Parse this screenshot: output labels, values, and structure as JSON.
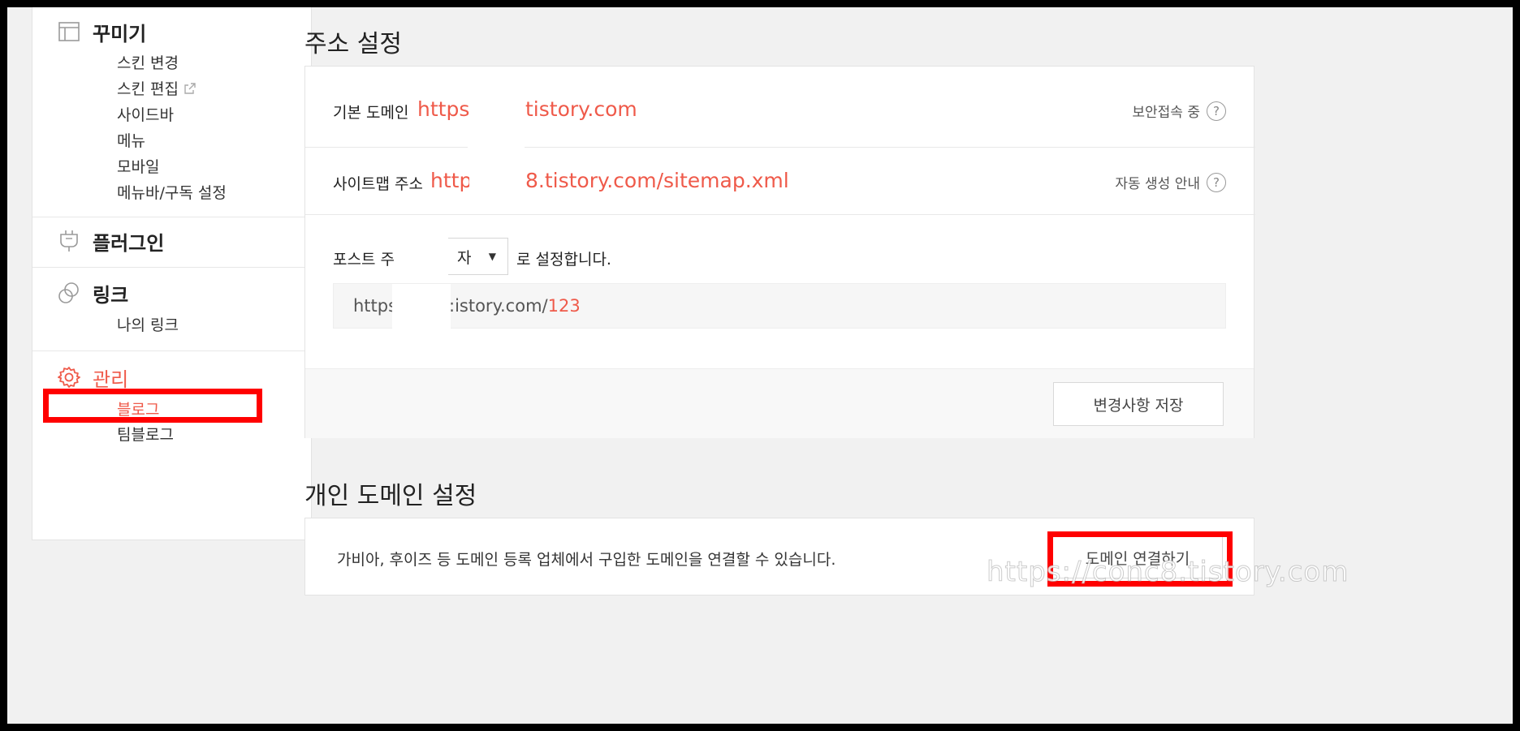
{
  "sidebar": {
    "decorate": {
      "label": "꾸미기",
      "icon": "layout-icon",
      "items": [
        "스킨 변경",
        "스킨 편집",
        "사이드바",
        "메뉴",
        "모바일",
        "메뉴바/구독 설정"
      ]
    },
    "plugin": {
      "label": "플러그인",
      "icon": "plug-icon"
    },
    "link": {
      "label": "링크",
      "icon": "link-icon",
      "items": [
        "나의 링크"
      ]
    },
    "manage": {
      "label": "관리",
      "icon": "gear-icon",
      "items": [
        "블로그",
        "팀블로그"
      ],
      "active_item": "블로그"
    }
  },
  "address_settings": {
    "title": "주소 설정",
    "default_domain": {
      "label": "기본 도메인",
      "url_prefix": "https:/",
      "url_suffix": "tistory.com",
      "status": "보안접속 중",
      "help": "?"
    },
    "sitemap": {
      "label": "사이트맵 주소",
      "url_prefix": "https",
      "url_suffix": "8.tistory.com/sitemap.xml",
      "status": "자동 생성 안내",
      "help": "?"
    },
    "post_address": {
      "label": "포스트 주:",
      "select_value": "자",
      "suffix_text": "로 설정합니다.",
      "preview_prefix": "https:/",
      "preview_host": ":istory.com/",
      "preview_id": "123"
    },
    "save_button": "변경사항 저장"
  },
  "custom_domain": {
    "title": "개인 도메인 설정",
    "description": "가비아, 후이즈 등 도메인 등록 업체에서 구입한 도메인을 연결할 수 있습니다.",
    "connect_button": "도메인 연결하기"
  },
  "watermark": "https://conc8.tistory.com",
  "colors": {
    "accent": "#ef5a4a",
    "highlight_box": "#ff0000",
    "page_bg": "#f1f1f1"
  }
}
